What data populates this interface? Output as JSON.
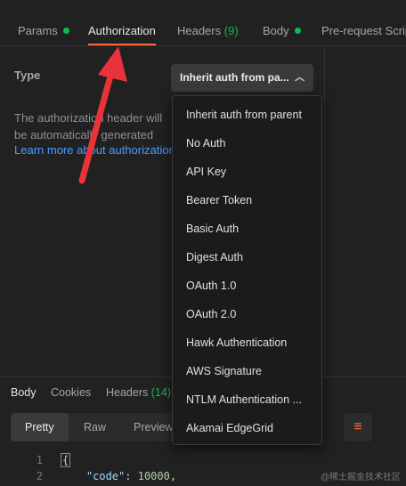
{
  "tabs": {
    "params": "Params",
    "authorization": "Authorization",
    "headers": "Headers",
    "headers_count": "(9)",
    "body": "Body",
    "prerequest": "Pre-request Script"
  },
  "auth": {
    "type_label": "Type",
    "description": "The authorization header will be automatically generated when you send the request.",
    "learn_more": "Learn more about authorization",
    "selected": "Inherit auth from pa...",
    "options": [
      "Inherit auth from parent",
      "No Auth",
      "API Key",
      "Bearer Token",
      "Basic Auth",
      "Digest Auth",
      "OAuth 1.0",
      "OAuth 2.0",
      "Hawk Authentication",
      "AWS Signature",
      "NTLM Authentication ...",
      "Akamai EdgeGrid"
    ]
  },
  "response": {
    "tabs": {
      "body": "Body",
      "cookies": "Cookies",
      "headers": "Headers",
      "headers_count": "(14)"
    },
    "formats": {
      "pretty": "Pretty",
      "raw": "Raw",
      "preview": "Preview"
    },
    "lines": [
      "1",
      "2"
    ],
    "line1": "{",
    "line2_key": "\"code\"",
    "line2_sep": ": ",
    "line2_value": "10000",
    "line2_end": ","
  },
  "watermark": "@稀土掘金技术社区",
  "colors": {
    "accent": "#ff6c37",
    "status_green": "#0cbb52",
    "link": "#4c9cff",
    "annotation_arrow": "#e8333a"
  }
}
